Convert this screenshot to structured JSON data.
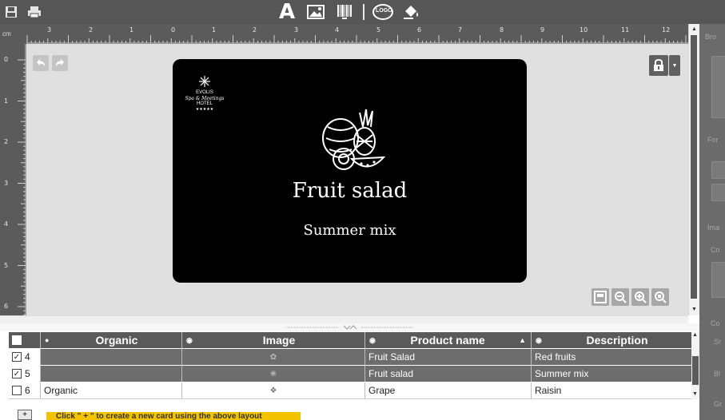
{
  "toolbar": {
    "tools": [
      "save-icon",
      "print-icon",
      "text-tool-icon",
      "image-tool-icon",
      "barcode-tool-icon",
      "logo-tool-icon",
      "color-fill-tool-icon"
    ],
    "logo_label": "LOGO"
  },
  "ruler": {
    "unit": "cm",
    "top_labels": [
      "3",
      "2",
      "1",
      "0",
      "1",
      "2",
      "3",
      "4",
      "5",
      "6",
      "7",
      "8",
      "9",
      "10",
      "11",
      "12"
    ],
    "left_labels": [
      "0",
      "1",
      "2",
      "3",
      "4",
      "5",
      "6"
    ]
  },
  "card": {
    "hotel_logo": {
      "line1": "EVOLIS",
      "line2": "Spa & Meetings",
      "line3": "HOTEL",
      "stars": "★★★★★"
    },
    "title": "Fruit salad",
    "subtitle": "Summer mix",
    "background": "#000000",
    "text_color": "#ffffff"
  },
  "table": {
    "columns": [
      {
        "label": "",
        "icon": "checkbox"
      },
      {
        "label": "Organic",
        "icon": "eye-slash-icon"
      },
      {
        "label": "Image",
        "icon": "eye-icon"
      },
      {
        "label": "Product name",
        "icon": "eye-icon",
        "sort": "▲"
      },
      {
        "label": "Description",
        "icon": "eye-icon"
      }
    ],
    "rows": [
      {
        "checked": true,
        "num": "4",
        "organic": "",
        "image": "raspberry-thumbnail",
        "product": "Fruit Salad",
        "description": "Red fruits",
        "selected": true
      },
      {
        "checked": true,
        "num": "5",
        "organic": "",
        "image": "fruit-thumbnail",
        "product": "Fruit salad",
        "description": "Summer mix",
        "selected": true
      },
      {
        "checked": false,
        "num": "6",
        "organic": "Organic",
        "image": "grape-thumbnail",
        "product": "Grape",
        "description": "Raisin",
        "selected": false
      }
    ]
  },
  "side_panel": {
    "labels": [
      "Bro",
      "For",
      "Ima",
      "Co",
      "Co",
      "Sr",
      "Bl",
      "Gr"
    ]
  },
  "bottom": {
    "add_symbol": "+",
    "hint": "Click \" + \" to create a new card using the above layout"
  },
  "colors": {
    "toolbar": "#565656",
    "canvas": "#e0e0e0",
    "selected_row": "#6d6d6d",
    "hint": "#f3c300"
  }
}
